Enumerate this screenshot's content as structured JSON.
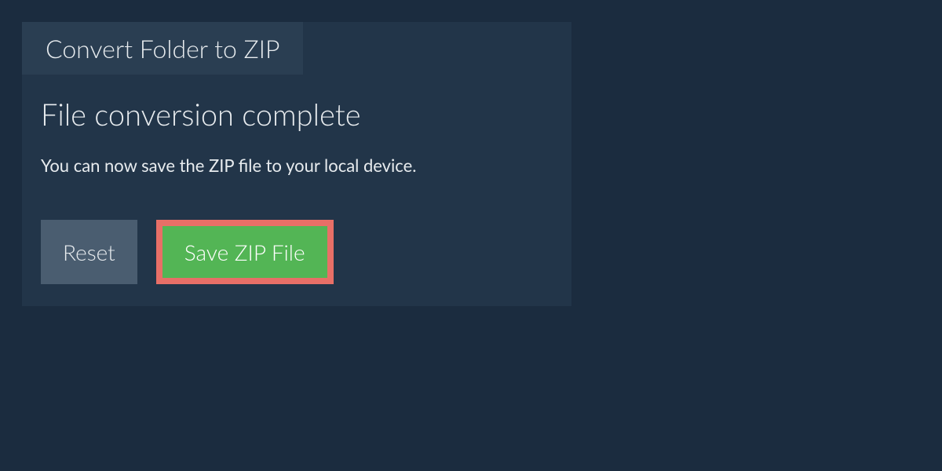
{
  "tab": {
    "title": "Convert Folder to ZIP"
  },
  "main": {
    "heading": "File conversion complete",
    "description": "You can now save the ZIP file to your local device."
  },
  "buttons": {
    "reset_label": "Reset",
    "save_label": "Save ZIP File"
  },
  "colors": {
    "background": "#1b2c3f",
    "panel": "#223549",
    "tab": "#2a3e52",
    "reset_button": "#4a5d70",
    "save_button": "#53b555",
    "save_button_border": "#e86f67",
    "text": "#e8ecef"
  }
}
